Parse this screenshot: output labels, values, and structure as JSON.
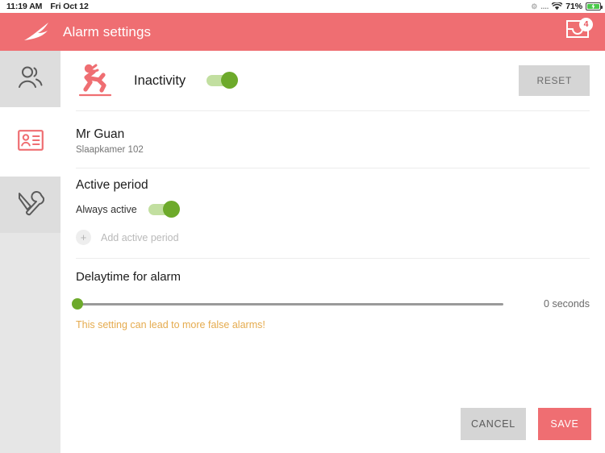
{
  "statusbar": {
    "time": "11:19 AM",
    "date": "Fri Oct 12",
    "dots": "....",
    "battery_percent": "71%",
    "wifi_icon": "wifi-icon",
    "battery_icon": "battery-charging-icon",
    "sync_icon": "sync-icon"
  },
  "header": {
    "title": "Alarm settings",
    "logo_icon": "swift-bird-logo",
    "notifications_icon": "inbox-tray-icon",
    "badge_count": "4",
    "color": "#ef6e72"
  },
  "sidebar": {
    "items": [
      {
        "name": "sidebar-item-residents",
        "icon": "people-group-icon",
        "active": false
      },
      {
        "name": "sidebar-item-profile",
        "icon": "id-card-icon",
        "active": true
      },
      {
        "name": "sidebar-item-tools",
        "icon": "tools-icon",
        "active": false
      }
    ]
  },
  "alarm": {
    "icon": "falling-person-icon",
    "label": "Inactivity",
    "toggle_on": true,
    "reset_label": "RESET"
  },
  "patient": {
    "name": "Mr Guan",
    "room": "Slaapkamer 102"
  },
  "active_period": {
    "title": "Active period",
    "always_active_label": "Always active",
    "always_active_on": true,
    "add_label": "Add active period",
    "add_icon": "plus-icon"
  },
  "delaytime": {
    "title": "Delaytime for alarm",
    "value_label": "0 seconds",
    "slider_value": 0,
    "slider_min": 0,
    "slider_max": 100,
    "warning": "This setting can lead to more false alarms!",
    "warning_color": "#e5ab4e"
  },
  "footer": {
    "cancel_label": "CANCEL",
    "save_label": "SAVE",
    "save_color": "#ef6e72"
  }
}
